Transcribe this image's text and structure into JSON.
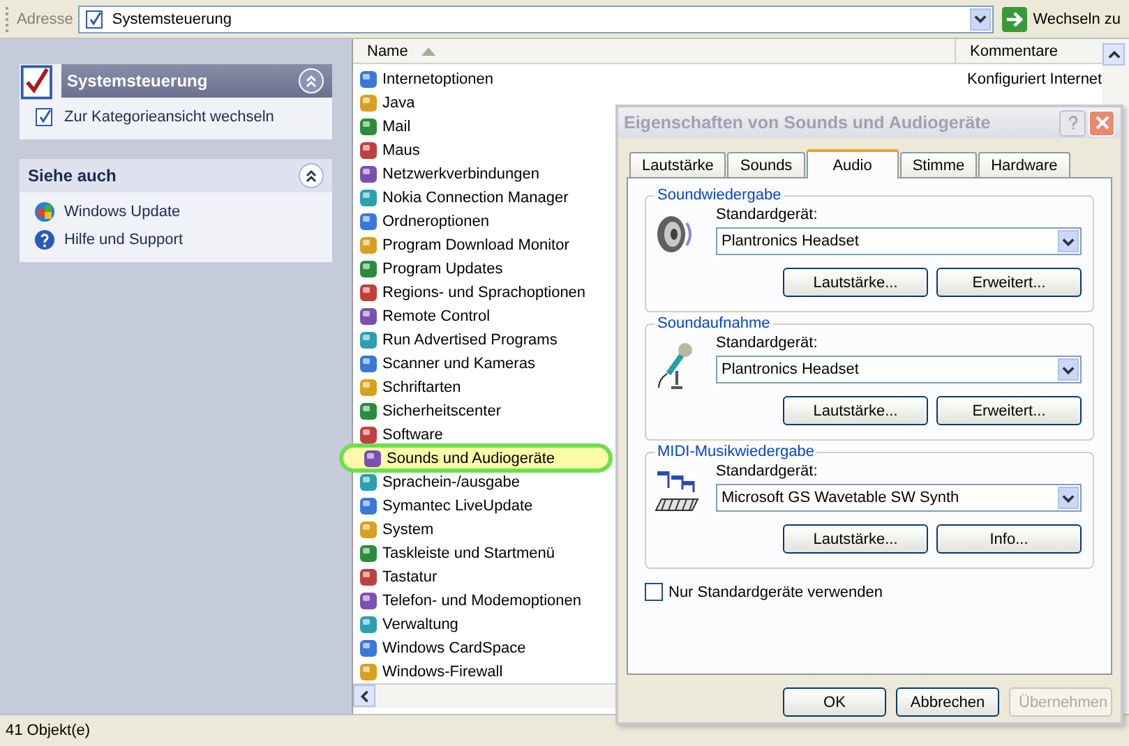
{
  "address_bar": {
    "label": "Adresse",
    "value": "Systemsteuerung",
    "go_button": "Wechseln zu"
  },
  "task_pane": [
    {
      "title": "Systemsteuerung",
      "kind": "primary",
      "expanded": true,
      "links": [
        "Zur Kategorieansicht wechseln"
      ]
    },
    {
      "title": "Siehe auch",
      "kind": "secondary",
      "expanded": true,
      "links": [
        "Windows Update",
        "Hilfe und Support"
      ]
    }
  ],
  "file_list": {
    "columns": [
      {
        "label": "Name",
        "sorted": true
      },
      {
        "label": "Kommentare",
        "sorted": false
      }
    ],
    "items": [
      {
        "name": "Internetoptionen",
        "comment": "Konfiguriert Internet",
        "selected": false
      },
      {
        "name": "Java",
        "selected": false
      },
      {
        "name": "Mail",
        "selected": false
      },
      {
        "name": "Maus",
        "selected": false
      },
      {
        "name": "Netzwerkverbindungen",
        "selected": false
      },
      {
        "name": "Nokia Connection Manager",
        "selected": false
      },
      {
        "name": "Ordneroptionen",
        "selected": false
      },
      {
        "name": "Program Download Monitor",
        "selected": false
      },
      {
        "name": "Program Updates",
        "selected": false
      },
      {
        "name": "Regions- und Sprachoptionen",
        "selected": false
      },
      {
        "name": "Remote Control",
        "selected": false
      },
      {
        "name": "Run Advertised Programs",
        "selected": false
      },
      {
        "name": "Scanner und Kameras",
        "selected": false
      },
      {
        "name": "Schriftarten",
        "selected": false
      },
      {
        "name": "Sicherheitscenter",
        "selected": false
      },
      {
        "name": "Software",
        "selected": false
      },
      {
        "name": "Sounds und Audiogeräte",
        "selected": true
      },
      {
        "name": "Sprachein-/ausgabe",
        "selected": false
      },
      {
        "name": "Symantec LiveUpdate",
        "selected": false
      },
      {
        "name": "System",
        "selected": false
      },
      {
        "name": "Taskleiste und Startmenü",
        "selected": false
      },
      {
        "name": "Tastatur",
        "selected": false
      },
      {
        "name": "Telefon- und Modemoptionen",
        "selected": false
      },
      {
        "name": "Verwaltung",
        "selected": false
      },
      {
        "name": "Windows CardSpace",
        "selected": false
      },
      {
        "name": "Windows-Firewall",
        "selected": false
      }
    ]
  },
  "status_bar": "41 Objekt(e)",
  "dialog": {
    "title": "Eigenschaften von Sounds und Audiogeräte",
    "tabs": [
      {
        "label": "Lautstärke",
        "selected": false
      },
      {
        "label": "Sounds",
        "selected": false
      },
      {
        "label": "Audio",
        "selected": true
      },
      {
        "label": "Stimme",
        "selected": false
      },
      {
        "label": "Hardware",
        "selected": false
      }
    ],
    "groups": [
      {
        "title": "Soundwiedergabe",
        "kind": "speaker",
        "label": "Standardgerät:",
        "device": "Plantronics Headset",
        "buttons": [
          "Lautstärke...",
          "Erweitert..."
        ]
      },
      {
        "title": "Soundaufnahme",
        "kind": "microphone",
        "label": "Standardgerät:",
        "device": "Plantronics Headset",
        "buttons": [
          "Lautstärke...",
          "Erweitert..."
        ]
      },
      {
        "title": "MIDI-Musikwiedergabe",
        "kind": "midi",
        "label": "Standardgerät:",
        "device": "Microsoft GS Wavetable SW Synth",
        "buttons": [
          "Lautstärke...",
          "Info..."
        ]
      }
    ],
    "checkbox": {
      "label": "Nur Standardgeräte verwenden",
      "checked": false
    },
    "buttons": [
      {
        "label": "OK",
        "disabled": false
      },
      {
        "label": "Abbrechen",
        "disabled": false
      },
      {
        "label": "Übernehmen",
        "disabled": true
      }
    ]
  }
}
